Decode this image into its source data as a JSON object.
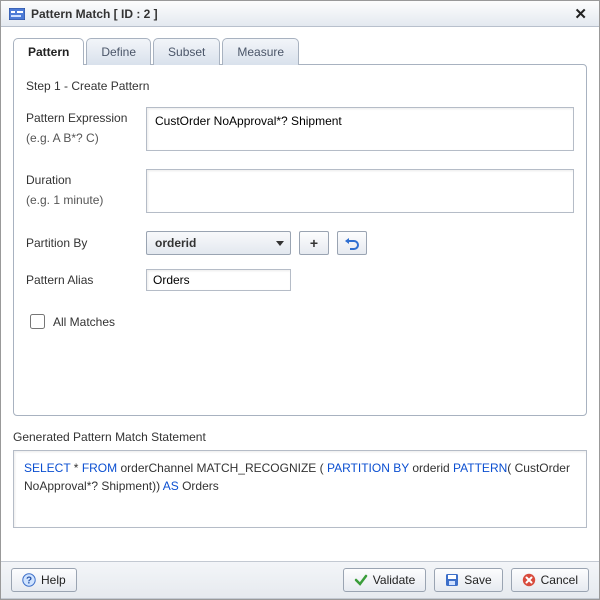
{
  "title": "Pattern Match [ ID : 2 ]",
  "tabs": [
    "Pattern",
    "Define",
    "Subset",
    "Measure"
  ],
  "activeTab": 0,
  "step": {
    "heading": "Step 1 - Create Pattern",
    "patternExpr": {
      "label": "Pattern Expression",
      "hint": "(e.g. A B*? C)",
      "value": "CustOrder NoApproval*? Shipment"
    },
    "duration": {
      "label": "Duration",
      "hint": "(e.g. 1 minute)",
      "value": ""
    },
    "partitionBy": {
      "label": "Partition By",
      "selected": "orderid"
    },
    "patternAlias": {
      "label": "Pattern Alias",
      "value": "Orders"
    },
    "allMatches": {
      "label": "All Matches",
      "checked": false
    }
  },
  "generated": {
    "label": "Generated Pattern Match Statement",
    "sql": {
      "pre": " * ",
      "from": " orderChannel  MATCH_RECOGNIZE ( ",
      "partKw": "PARTITION BY",
      "partVal": " orderid ",
      "patKw": "PATTERN",
      "patVal": "( CustOrder NoApproval*? Shipment)) ",
      "alias": " Orders"
    }
  },
  "buttons": {
    "help": "Help",
    "validate": "Validate",
    "save": "Save",
    "cancel": "Cancel"
  }
}
